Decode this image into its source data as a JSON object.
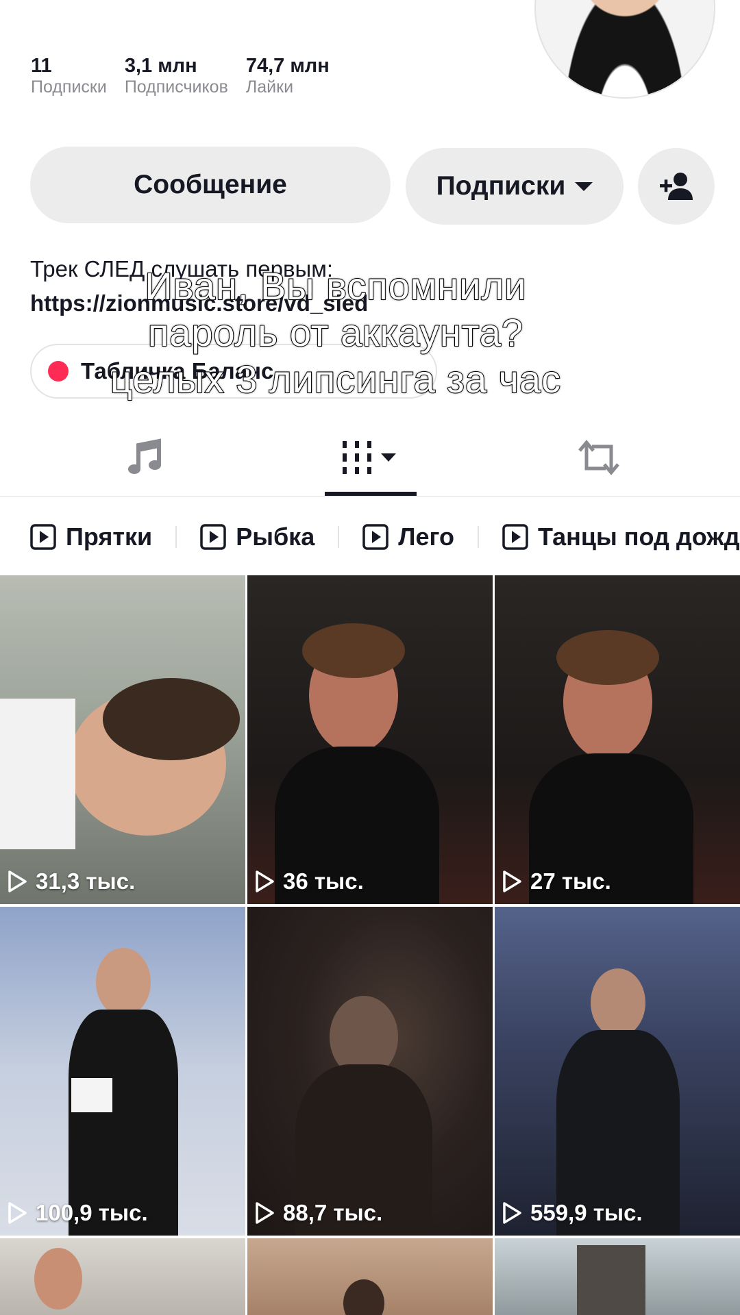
{
  "profile": {
    "stats": [
      {
        "value": "11",
        "label": "Подписки"
      },
      {
        "value": "3,1 млн",
        "label": "Подписчиков"
      },
      {
        "value": "74,7 млн",
        "label": "Лайки"
      }
    ],
    "message_button": "Сообщение",
    "following_button": "Подписки",
    "bio_line1": "Трек СЛЕД слушать первым:",
    "bio_link": "https://zionmusic.store/vd_sled",
    "playlist_chip": "Табличка Баланс"
  },
  "overlay": {
    "line1": "Иван, Вы вспомнили",
    "line2": "пароль от аккаунта?",
    "line3": "целых 3 липсинга за час"
  },
  "tabs": {
    "music": "music-note-icon",
    "videos": "grid-icon",
    "reposts": "repost-icon"
  },
  "playlists": [
    "Прятки",
    "Рыбка",
    "Лего",
    "Танцы под дожд"
  ],
  "videos": [
    {
      "views": "31,3 тыс."
    },
    {
      "views": "36 тыс."
    },
    {
      "views": "27 тыс."
    },
    {
      "views": "100,9 тыс."
    },
    {
      "views": "88,7 тыс."
    },
    {
      "views": "559,9 тыс."
    }
  ],
  "colors": {
    "accent": "#fe2c55",
    "text": "#161823",
    "button_bg": "#ececec"
  }
}
